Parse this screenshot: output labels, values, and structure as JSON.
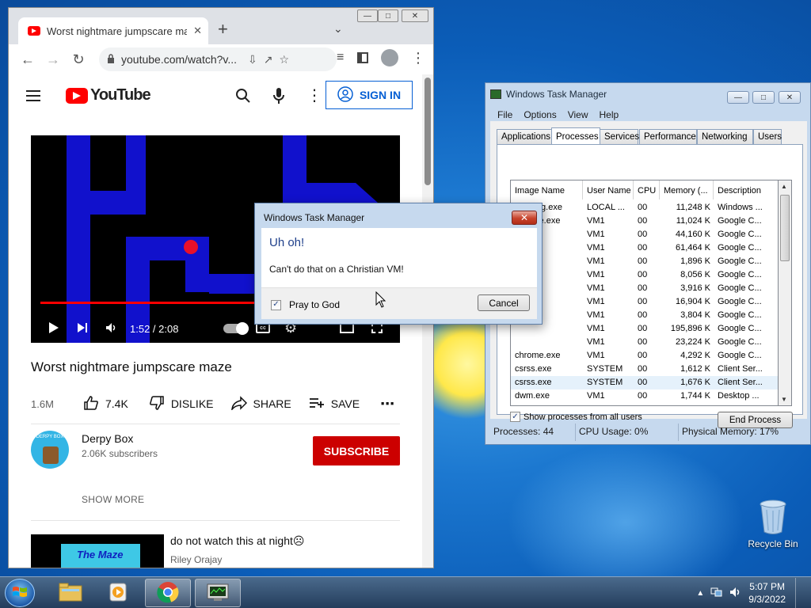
{
  "chrome": {
    "tab_title": "Worst nightmare jumpscare maze",
    "url": "youtube.com/watch?v..."
  },
  "youtube": {
    "sign_in": "SIGN IN",
    "player": {
      "current_time": "1:52 / 2:08",
      "progress": 0.875
    },
    "video_title": "Worst nightmare jumpscare maze",
    "views": "1.6M",
    "actions": {
      "like_count": "7.4K",
      "dislike": "DISLIKE",
      "share": "SHARE",
      "save": "SAVE"
    },
    "channel": {
      "name": "Derpy Box",
      "subscribers": "2.06K subscribers",
      "avatar_text": "DERPY BOX",
      "subscribe": "SUBSCRIBE",
      "show_more": "SHOW MORE"
    },
    "recommendation": {
      "title": "do not watch this at night☹",
      "channel": "Riley Orajay",
      "thumb_text": "The Maze"
    }
  },
  "task_manager": {
    "title": "Windows Task Manager",
    "menu": [
      "File",
      "Options",
      "View",
      "Help"
    ],
    "tabs": [
      "Applications",
      "Processes",
      "Services",
      "Performance",
      "Networking",
      "Users"
    ],
    "active_tab": "Processes",
    "columns": [
      "Image Name",
      "User Name",
      "CPU",
      "Memory (...",
      "Description"
    ],
    "rows": [
      [
        "audiodg.exe",
        "LOCAL ...",
        "00",
        "11,248 K",
        "Windows ..."
      ],
      [
        "chrome.exe",
        "VM1",
        "00",
        "11,024 K",
        "Google C..."
      ],
      [
        "",
        "VM1",
        "00",
        "44,160 K",
        "Google C..."
      ],
      [
        "",
        "VM1",
        "00",
        "61,464 K",
        "Google C..."
      ],
      [
        "",
        "VM1",
        "00",
        "1,896 K",
        "Google C..."
      ],
      [
        "",
        "VM1",
        "00",
        "8,056 K",
        "Google C..."
      ],
      [
        "",
        "VM1",
        "00",
        "3,916 K",
        "Google C..."
      ],
      [
        "",
        "VM1",
        "00",
        "16,904 K",
        "Google C..."
      ],
      [
        "",
        "VM1",
        "00",
        "3,804 K",
        "Google C..."
      ],
      [
        "",
        "VM1",
        "00",
        "195,896 K",
        "Google C..."
      ],
      [
        "",
        "VM1",
        "00",
        "23,224 K",
        "Google C..."
      ],
      [
        "chrome.exe",
        "VM1",
        "00",
        "4,292 K",
        "Google C..."
      ],
      [
        "csrss.exe",
        "SYSTEM",
        "00",
        "1,612 K",
        "Client Ser..."
      ],
      [
        "csrss.exe",
        "SYSTEM",
        "00",
        "1,676 K",
        "Client Ser..."
      ],
      [
        "dwm.exe",
        "VM1",
        "00",
        "1,744 K",
        "Desktop ..."
      ]
    ],
    "selected_row": 13,
    "show_all_label": "Show processes from all users",
    "end_process": "End Process",
    "status": {
      "processes": "Processes: 44",
      "cpu": "CPU Usage: 0%",
      "memory": "Physical Memory: 17%"
    }
  },
  "dialog": {
    "title": "Windows Task Manager",
    "heading": "Uh oh!",
    "message": "Can't do that on a Christian VM!",
    "checkbox_label": "Pray to God",
    "cancel": "Cancel"
  },
  "desktop": {
    "recycle_bin": "Recycle Bin"
  },
  "taskbar": {
    "time": "5:07 PM",
    "date": "9/3/2022"
  }
}
